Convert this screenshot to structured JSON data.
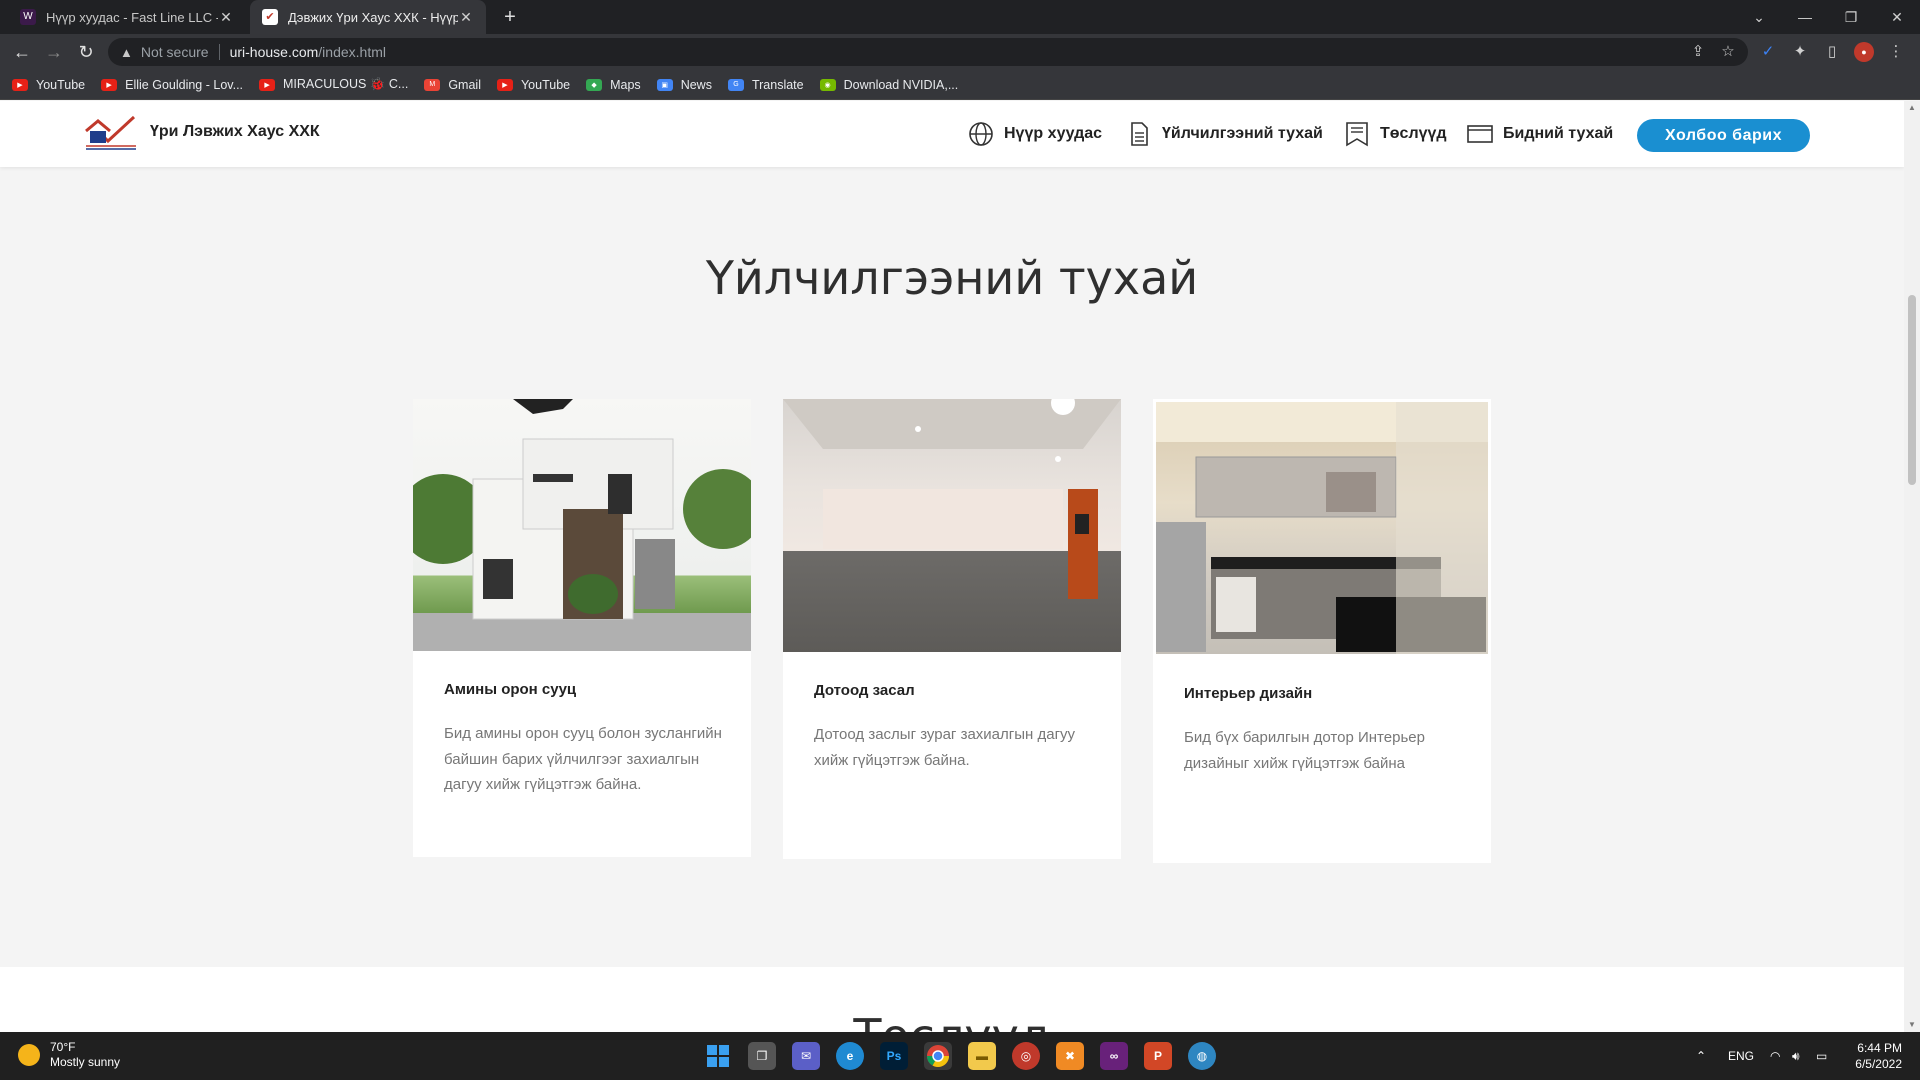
{
  "browser": {
    "tabs": [
      {
        "title": "Нүүр хуудас - Fast Line LLC - Bet",
        "active": false
      },
      {
        "title": "Дэвжих Үри Хаус ХХК - Нүүр хуу",
        "active": true
      }
    ],
    "url": {
      "security": "Not secure",
      "domain": "uri-house.com",
      "path": "/index.html"
    },
    "bookmarks": [
      {
        "label": "YouTube",
        "icon": "youtube-icon"
      },
      {
        "label": "Ellie Goulding - Lov...",
        "icon": "youtube-icon"
      },
      {
        "label": "MIRACULOUS 🐞 C...",
        "icon": "youtube-icon"
      },
      {
        "label": "Gmail",
        "icon": "gmail-icon"
      },
      {
        "label": "YouTube",
        "icon": "youtube-icon"
      },
      {
        "label": "Maps",
        "icon": "maps-icon"
      },
      {
        "label": "News",
        "icon": "news-icon"
      },
      {
        "label": "Translate",
        "icon": "translate-icon"
      },
      {
        "label": "Download NVIDIA,...",
        "icon": "nvidia-icon"
      }
    ]
  },
  "site": {
    "brand": "Үри Лэвжих Хаус ХХК",
    "nav": [
      {
        "label": "Нүүр хуудас",
        "icon": "globe-icon"
      },
      {
        "label": "Үйлчилгээний тухай",
        "icon": "document-icon"
      },
      {
        "label": "Төслүүд",
        "icon": "bookmark-icon"
      },
      {
        "label": "Бидний тухай",
        "icon": "card-icon"
      }
    ],
    "cta": "Холбоо барих"
  },
  "section": {
    "title": "Үйлчилгээний тухай",
    "cards": [
      {
        "title": "Амины орон сууц",
        "description": "Бид амины орон сууц болон зуслангийн байшин барих үйлчилгээг захиалгын дагуу хийж гүйцэтгэж байна.",
        "image": "house-exterior"
      },
      {
        "title": "Дотоод засал",
        "description": "Дотоод заслыг зураг захиалгын дагуу хийж гүйцэтгэж байна.",
        "image": "empty-interior-room"
      },
      {
        "title": "Интерьер дизайн",
        "description": "Бид бүх барилгын дотор Интерьер дизайныг хийж гүйцэтгэж байна",
        "image": "modern-kitchen"
      }
    ],
    "next_title": "Төслүүд"
  },
  "taskbar": {
    "weather": {
      "temp": "70°F",
      "condition": "Mostly sunny"
    },
    "lang": "ENG",
    "time": "6:44 PM",
    "date": "6/5/2022"
  }
}
